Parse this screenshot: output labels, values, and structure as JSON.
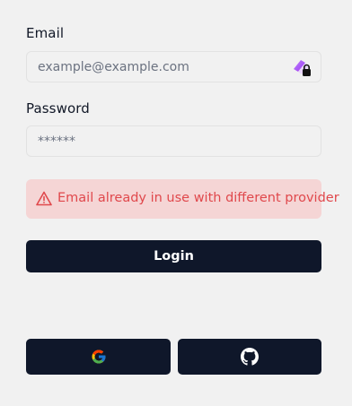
{
  "form": {
    "email": {
      "label": "Email",
      "placeholder": "example@example.com",
      "value": ""
    },
    "password": {
      "label": "Password",
      "placeholder": "******",
      "value": ""
    },
    "error": {
      "icon": "warning-triangle-icon",
      "message": "Email already in use with different provider",
      "color": "#e0484c"
    },
    "login_label": "Login"
  },
  "social": [
    {
      "provider_icon": "google-icon"
    },
    {
      "provider_icon": "github-icon"
    }
  ],
  "colors": {
    "background": "#f1f1f1",
    "button": "#0f172a",
    "error_background": "#f5d5d5",
    "error_text": "#e0484c"
  }
}
